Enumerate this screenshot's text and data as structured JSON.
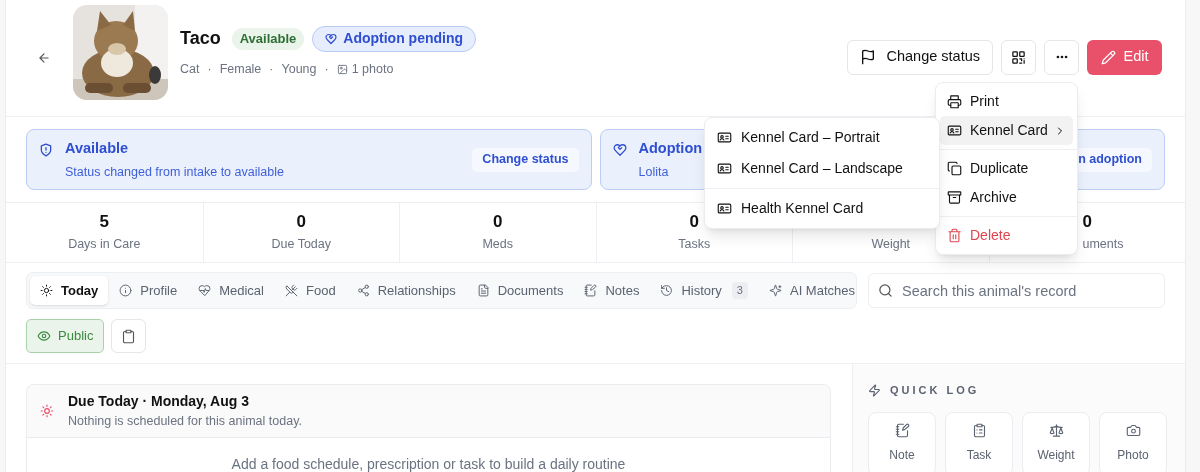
{
  "header": {
    "name": "Taco",
    "status_badge": "Available",
    "adoption_badge": "Adoption pending",
    "meta": [
      "Cat",
      "Female",
      "Young"
    ],
    "separator": "·",
    "photos": "1 photo",
    "photo": {
      "kind": "picture"
    }
  },
  "actions": {
    "change_status": "Change status",
    "edit": "Edit"
  },
  "status_cards": [
    {
      "title": "Available",
      "text": "Status changed from intake to available",
      "button": "Change status"
    },
    {
      "title": "Adoption",
      "text": "Lolita",
      "button": "n adoption"
    }
  ],
  "stats": [
    {
      "value": "5",
      "label": "Days in Care"
    },
    {
      "value": "0",
      "label": "Due Today"
    },
    {
      "value": "0",
      "label": "Meds"
    },
    {
      "value": "0",
      "label": "Tasks"
    },
    {
      "label": "Weight"
    },
    {
      "value": "0",
      "label": "uments"
    }
  ],
  "tabs": [
    {
      "label": "Today",
      "selected": true
    },
    {
      "label": "Profile",
      "selected": false
    },
    {
      "label": "Medical",
      "selected": false
    },
    {
      "label": "Food",
      "selected": false
    },
    {
      "label": "Relationships",
      "selected": false
    },
    {
      "label": "Documents",
      "selected": false
    },
    {
      "label": "Notes",
      "selected": false
    },
    {
      "label": "History",
      "selected": false,
      "count": "3"
    },
    {
      "label": "AI Matches",
      "selected": false
    }
  ],
  "search": {
    "placeholder": "Search this animal's record"
  },
  "visibility": {
    "label": "Public",
    "on": true
  },
  "due_today": {
    "title": "Due Today · Monday, Aug 3",
    "subtitle": "Nothing is scheduled for this animal today.",
    "empty": "Add a food schedule, prescription or task to build a daily routine"
  },
  "quick_log": {
    "title": "QUICK LOG",
    "buttons": [
      "Note",
      "Task",
      "Weight",
      "Photo"
    ]
  },
  "menu": {
    "groups": [
      [
        {
          "label": "Print",
          "kind": "action",
          "selected": false
        },
        {
          "label": "Kennel Card",
          "kind": "submenu",
          "selected": true
        }
      ],
      [
        {
          "label": "Duplicate",
          "kind": "action",
          "selected": false
        },
        {
          "label": "Archive",
          "kind": "action",
          "selected": false
        }
      ],
      [
        {
          "label": "Delete",
          "kind": "destructive",
          "selected": false
        }
      ]
    ]
  },
  "submenu": {
    "groups": [
      [
        {
          "label": "Kennel Card – Portrait"
        },
        {
          "label": "Kennel Card – Landscape"
        }
      ],
      [
        {
          "label": "Health Kennel Card"
        }
      ]
    ]
  }
}
